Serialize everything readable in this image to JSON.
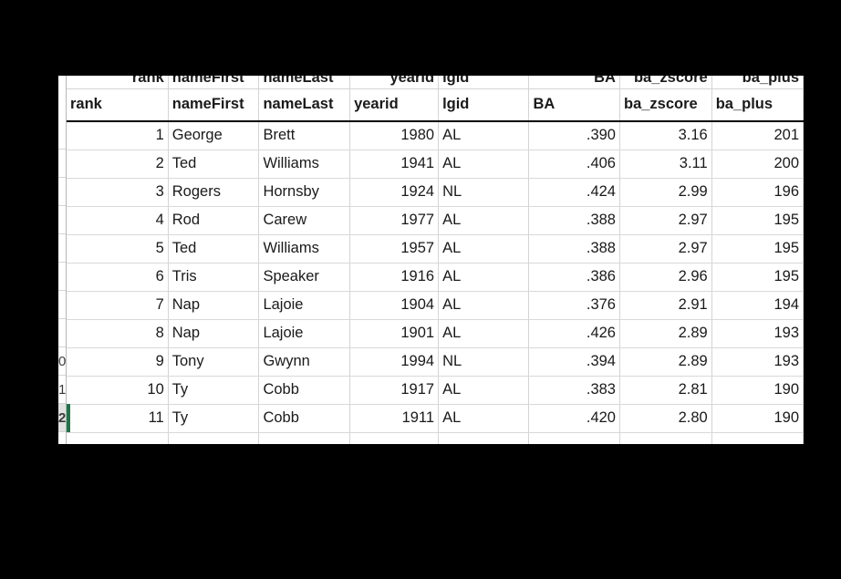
{
  "app": {
    "type": "spreadsheet",
    "selection_color": "#217346",
    "header_rule_color": "#000000",
    "gridline_color": "#d4d4d4"
  },
  "table": {
    "columns": [
      {
        "key": "rank",
        "label": "rank",
        "align": "right"
      },
      {
        "key": "nameFirst",
        "label": "nameFirst",
        "align": "left"
      },
      {
        "key": "nameLast",
        "label": "nameLast",
        "align": "left"
      },
      {
        "key": "yearid",
        "label": "yearid",
        "align": "right"
      },
      {
        "key": "lgid",
        "label": "lgid",
        "align": "left"
      },
      {
        "key": "BA",
        "label": "BA",
        "align": "right"
      },
      {
        "key": "ba_zscore",
        "label": "ba_zscore",
        "align": "right"
      },
      {
        "key": "ba_plus",
        "label": "ba_plus",
        "align": "right"
      }
    ],
    "rows": [
      {
        "rank": "1",
        "nameFirst": "George",
        "nameLast": "Brett",
        "yearid": "1980",
        "lgid": "AL",
        "BA": ".390",
        "ba_zscore": "3.16",
        "ba_plus": "201"
      },
      {
        "rank": "2",
        "nameFirst": "Ted",
        "nameLast": "Williams",
        "yearid": "1941",
        "lgid": "AL",
        "BA": ".406",
        "ba_zscore": "3.11",
        "ba_plus": "200"
      },
      {
        "rank": "3",
        "nameFirst": "Rogers",
        "nameLast": "Hornsby",
        "yearid": "1924",
        "lgid": "NL",
        "BA": ".424",
        "ba_zscore": "2.99",
        "ba_plus": "196"
      },
      {
        "rank": "4",
        "nameFirst": "Rod",
        "nameLast": "Carew",
        "yearid": "1977",
        "lgid": "AL",
        "BA": ".388",
        "ba_zscore": "2.97",
        "ba_plus": "195"
      },
      {
        "rank": "5",
        "nameFirst": "Ted",
        "nameLast": "Williams",
        "yearid": "1957",
        "lgid": "AL",
        "BA": ".388",
        "ba_zscore": "2.97",
        "ba_plus": "195"
      },
      {
        "rank": "6",
        "nameFirst": "Tris",
        "nameLast": "Speaker",
        "yearid": "1916",
        "lgid": "AL",
        "BA": ".386",
        "ba_zscore": "2.96",
        "ba_plus": "195"
      },
      {
        "rank": "7",
        "nameFirst": "Nap",
        "nameLast": "Lajoie",
        "yearid": "1904",
        "lgid": "AL",
        "BA": ".376",
        "ba_zscore": "2.91",
        "ba_plus": "194"
      },
      {
        "rank": "8",
        "nameFirst": "Nap",
        "nameLast": "Lajoie",
        "yearid": "1901",
        "lgid": "AL",
        "BA": ".426",
        "ba_zscore": "2.89",
        "ba_plus": "193"
      },
      {
        "rank": "9",
        "nameFirst": "Tony",
        "nameLast": "Gwynn",
        "yearid": "1994",
        "lgid": "NL",
        "BA": ".394",
        "ba_zscore": "2.89",
        "ba_plus": "193"
      },
      {
        "rank": "10",
        "nameFirst": "Ty",
        "nameLast": "Cobb",
        "yearid": "1917",
        "lgid": "AL",
        "BA": ".383",
        "ba_zscore": "2.81",
        "ba_plus": "190"
      },
      {
        "rank": "11",
        "nameFirst": "Ty",
        "nameLast": "Cobb",
        "yearid": "1911",
        "lgid": "AL",
        "BA": ".420",
        "ba_zscore": "2.80",
        "ba_plus": "190"
      }
    ]
  },
  "gutter": {
    "visible_row_labels": [
      "",
      "",
      "",
      "",
      "",
      "",
      "",
      "",
      "0",
      "1",
      "2"
    ],
    "selected_index": 10
  }
}
